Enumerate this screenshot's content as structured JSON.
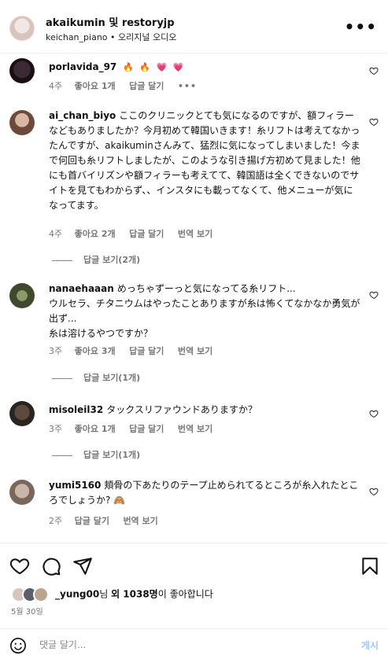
{
  "header": {
    "title": "akaikumin 및 restoryjp",
    "subtitle": "keichan_piano • 오리지널 오디오",
    "more_icon": "more-horizontal-icon"
  },
  "comments": [
    {
      "user": "porlavida_97",
      "text": "🔥 🔥 💗 💗",
      "time": "4주",
      "likes": "좋아요 1개",
      "reply": "답글 달기",
      "more": "•••"
    },
    {
      "user": "ai_chan_biyo",
      "text": "ここのクリニックとても気になるのですが、額フィラーなどもありましたか？今月初めて韓国いきます！糸リフトは考えてなかったんですが、akaikuminさんみて、猛烈に気になってしまいました！今まで何回も糸リフトしましたが、このような引き揚げ方初めて見ました！他にも首バイリズンや額フィラーも考えてて、韓国語は全くできないのでサイトを見てもわからず、、インスタにも載ってなくて、他メニューが気になってます。",
      "time": "4주",
      "likes": "좋아요 2개",
      "reply": "답글 달기",
      "translate": "번역 보기",
      "view_replies": "답글 보기(2개)"
    },
    {
      "user": "nanaehaaan",
      "text": "めっちゃずーっと気になってる糸リフト...\nウルセラ、チタニウムはやったことありますが糸は怖くてなかなか勇気が出ず...\n糸は溶けるやつですか？",
      "time": "3주",
      "likes": "좋아요 3개",
      "reply": "답글 달기",
      "translate": "번역 보기",
      "view_replies": "답글 보기(1개)"
    },
    {
      "user": "misoleil32",
      "text": "タックスリファウンドありますか？",
      "time": "3주",
      "likes": "좋아요 1개",
      "reply": "답글 달기",
      "translate": "번역 보기",
      "view_replies": "답글 보기(1개)"
    },
    {
      "user": "yumi5160",
      "text": "頬骨の下あたりのテープ止められてるところが糸入れたところでしょうか? 🙈",
      "time": "2주",
      "reply": "답글 달기",
      "translate": "번역 보기"
    }
  ],
  "actions": {
    "like_icon": "heart-icon",
    "comment_icon": "comment-icon",
    "share_icon": "send-icon",
    "save_icon": "bookmark-icon",
    "likes_user": "_yung00",
    "likes_mid": "님 ",
    "likes_others": "외 1038명",
    "likes_suffix": "이 좋아합니다",
    "date": "5월 30일"
  },
  "comment_input": {
    "placeholder": "댓글 달기...",
    "post_label": "게시"
  },
  "colors": {
    "post_disabled": "#9ec9f6",
    "meta_gray": "#777777"
  }
}
